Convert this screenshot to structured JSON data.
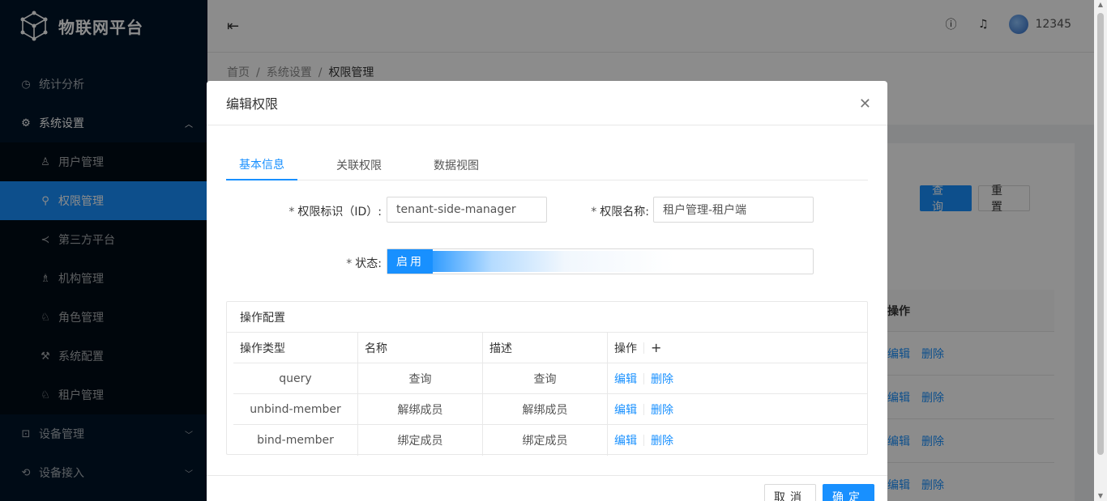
{
  "app": {
    "title": "物联网平台"
  },
  "sidebar": {
    "items": [
      {
        "label": "统计分析",
        "icon": "dashboard-icon"
      },
      {
        "label": "系统设置",
        "icon": "gear-icon",
        "open": true
      },
      {
        "label": "用户管理",
        "icon": "user-icon"
      },
      {
        "label": "权限管理",
        "icon": "key-icon",
        "active": true
      },
      {
        "label": "第三方平台",
        "icon": "share-icon"
      },
      {
        "label": "机构管理",
        "icon": "org-icon"
      },
      {
        "label": "角色管理",
        "icon": "role-icon"
      },
      {
        "label": "系统配置",
        "icon": "tool-icon"
      },
      {
        "label": "租户管理",
        "icon": "tenant-icon"
      },
      {
        "label": "设备管理",
        "icon": "device-icon"
      },
      {
        "label": "设备接入",
        "icon": "access-icon"
      }
    ]
  },
  "header": {
    "username": "12345"
  },
  "breadcrumb": {
    "home": "首页",
    "level2": "系统设置",
    "current": "权限管理"
  },
  "background": {
    "query_btn": "查询",
    "reset_btn": "重置",
    "table_header": "操作",
    "row_edit": "编辑",
    "row_delete": "删除"
  },
  "modal": {
    "title": "编辑权限",
    "tabs": [
      "基本信息",
      "关联权限",
      "数据视图"
    ],
    "form": {
      "id_label": "权限标识（ID）:",
      "id_value": "tenant-side-manager",
      "name_label": "权限名称:",
      "name_value": "租户管理-租户端",
      "status_label": "状态:",
      "status_value": "启用"
    },
    "ops": {
      "title": "操作配置",
      "columns": [
        "操作类型",
        "名称",
        "描述",
        "操作"
      ],
      "rows": [
        {
          "type": "query",
          "name": "查询",
          "desc": "查询"
        },
        {
          "type": "unbind-member",
          "name": "解绑成员",
          "desc": "解绑成员"
        },
        {
          "type": "bind-member",
          "name": "绑定成员",
          "desc": "绑定成员"
        }
      ],
      "edit": "编辑",
      "delete": "删除"
    },
    "cancel": "取消",
    "ok": "确定"
  },
  "colors": {
    "primary": "#1890ff",
    "sider": "#001529"
  }
}
